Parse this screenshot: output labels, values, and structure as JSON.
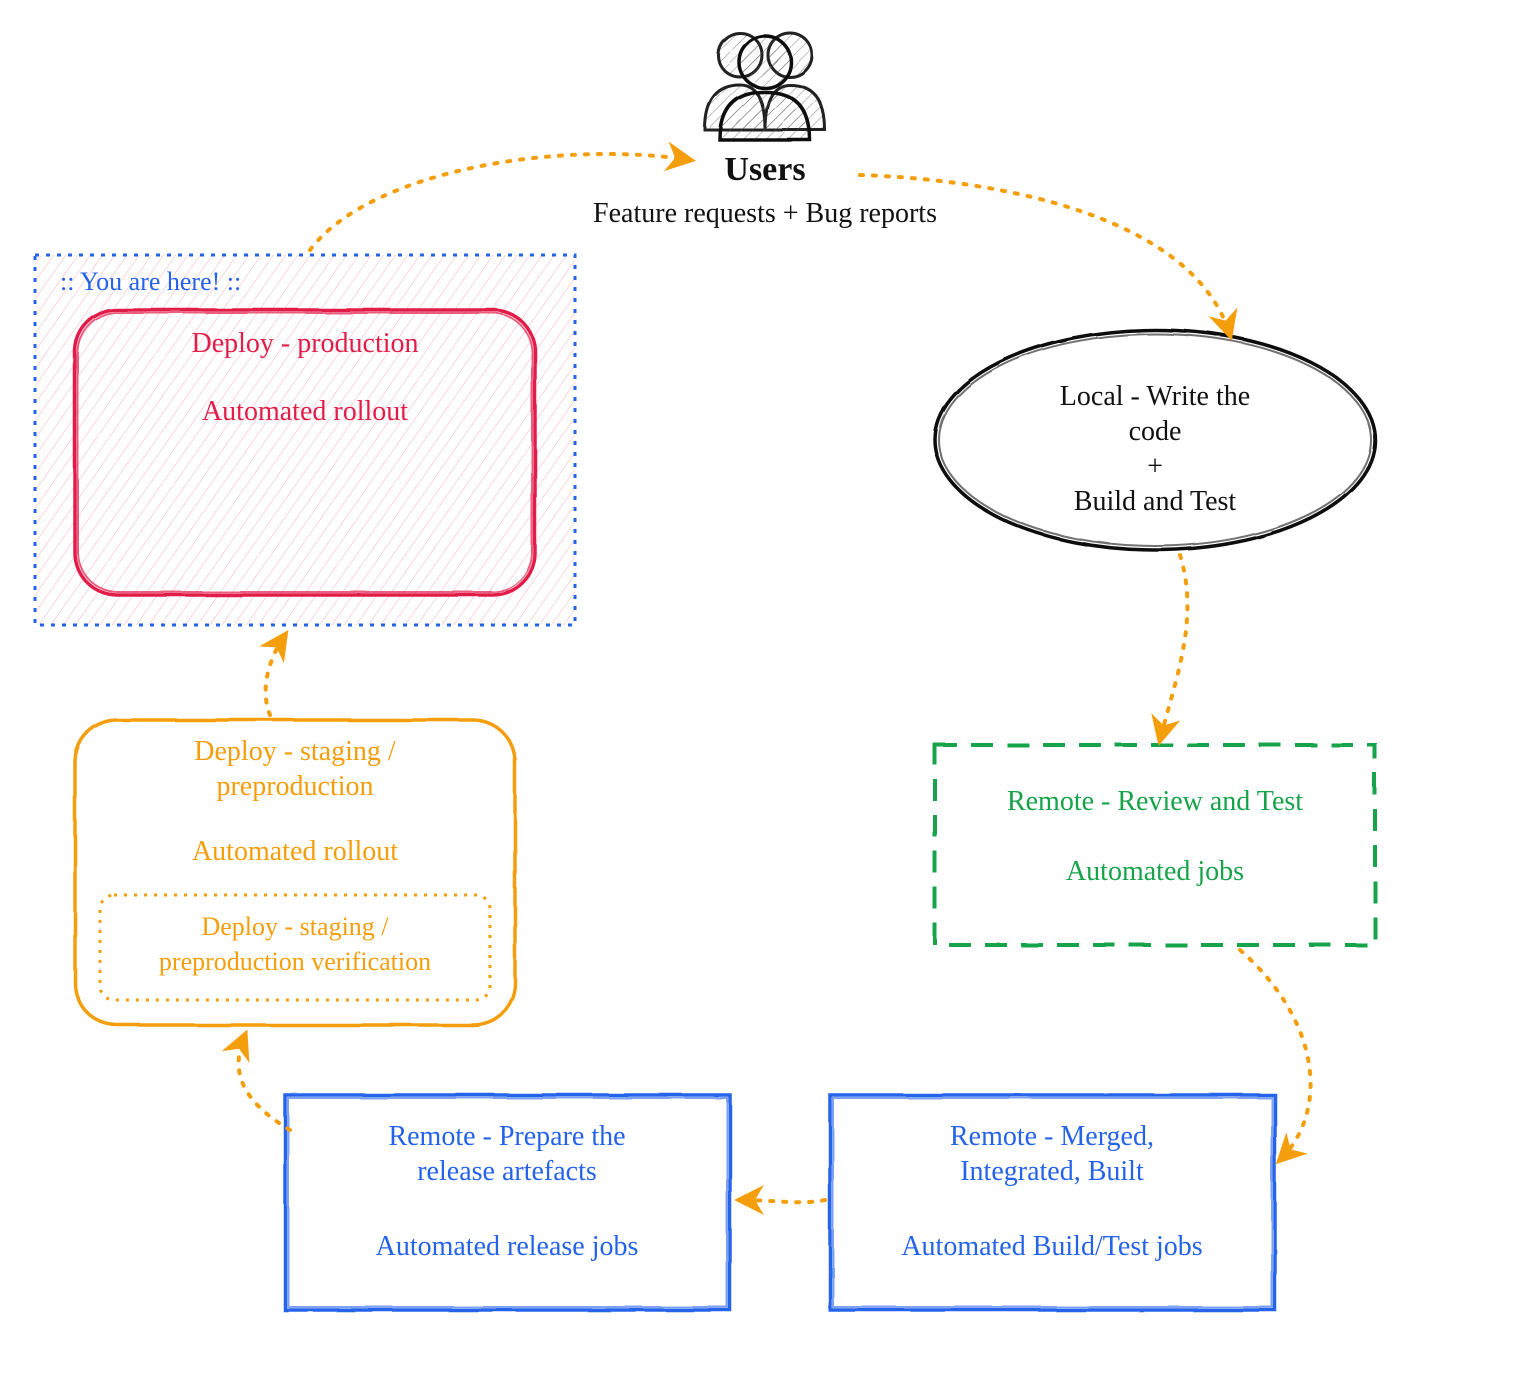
{
  "users": {
    "label": "Users",
    "subtitle": "Feature requests + Bug reports"
  },
  "you_are_here_label": ":: You are here! ::",
  "nodes": {
    "production": {
      "title": "Deploy - production",
      "subtitle": "Automated rollout"
    },
    "local": {
      "line1": "Local - Write the",
      "line2": "code",
      "line3": "+",
      "line4": "Build and Test"
    },
    "staging": {
      "title1": "Deploy - staging /",
      "title2": "preproduction",
      "subtitle": "Automated rollout",
      "inner1": "Deploy - staging /",
      "inner2": "preproduction verification"
    },
    "review": {
      "title": "Remote - Review and Test",
      "subtitle": "Automated jobs"
    },
    "prepare": {
      "title1": "Remote - Prepare the",
      "title2": "release artefacts",
      "subtitle": "Automated release jobs"
    },
    "merged": {
      "title1": "Remote - Merged,",
      "title2": "Integrated, Built",
      "subtitle": "Automated Build/Test jobs"
    }
  },
  "colors": {
    "orange": "#F59E0B",
    "red": "#E11D48",
    "blue": "#2563EB",
    "green": "#16A34A",
    "black": "#111111"
  }
}
